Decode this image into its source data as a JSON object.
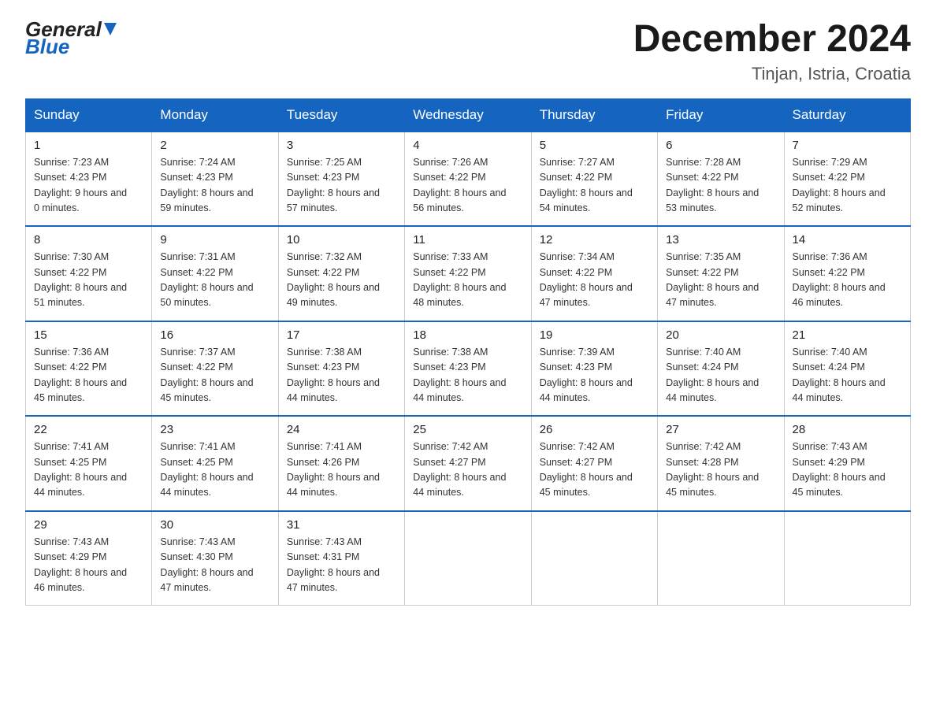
{
  "header": {
    "logo_line1": "General",
    "logo_line2": "Blue",
    "title": "December 2024",
    "subtitle": "Tinjan, Istria, Croatia"
  },
  "days_of_week": [
    "Sunday",
    "Monday",
    "Tuesday",
    "Wednesday",
    "Thursday",
    "Friday",
    "Saturday"
  ],
  "weeks": [
    [
      {
        "day": "1",
        "sunrise": "7:23 AM",
        "sunset": "4:23 PM",
        "daylight": "9 hours and 0 minutes."
      },
      {
        "day": "2",
        "sunrise": "7:24 AM",
        "sunset": "4:23 PM",
        "daylight": "8 hours and 59 minutes."
      },
      {
        "day": "3",
        "sunrise": "7:25 AM",
        "sunset": "4:23 PM",
        "daylight": "8 hours and 57 minutes."
      },
      {
        "day": "4",
        "sunrise": "7:26 AM",
        "sunset": "4:22 PM",
        "daylight": "8 hours and 56 minutes."
      },
      {
        "day": "5",
        "sunrise": "7:27 AM",
        "sunset": "4:22 PM",
        "daylight": "8 hours and 54 minutes."
      },
      {
        "day": "6",
        "sunrise": "7:28 AM",
        "sunset": "4:22 PM",
        "daylight": "8 hours and 53 minutes."
      },
      {
        "day": "7",
        "sunrise": "7:29 AM",
        "sunset": "4:22 PM",
        "daylight": "8 hours and 52 minutes."
      }
    ],
    [
      {
        "day": "8",
        "sunrise": "7:30 AM",
        "sunset": "4:22 PM",
        "daylight": "8 hours and 51 minutes."
      },
      {
        "day": "9",
        "sunrise": "7:31 AM",
        "sunset": "4:22 PM",
        "daylight": "8 hours and 50 minutes."
      },
      {
        "day": "10",
        "sunrise": "7:32 AM",
        "sunset": "4:22 PM",
        "daylight": "8 hours and 49 minutes."
      },
      {
        "day": "11",
        "sunrise": "7:33 AM",
        "sunset": "4:22 PM",
        "daylight": "8 hours and 48 minutes."
      },
      {
        "day": "12",
        "sunrise": "7:34 AM",
        "sunset": "4:22 PM",
        "daylight": "8 hours and 47 minutes."
      },
      {
        "day": "13",
        "sunrise": "7:35 AM",
        "sunset": "4:22 PM",
        "daylight": "8 hours and 47 minutes."
      },
      {
        "day": "14",
        "sunrise": "7:36 AM",
        "sunset": "4:22 PM",
        "daylight": "8 hours and 46 minutes."
      }
    ],
    [
      {
        "day": "15",
        "sunrise": "7:36 AM",
        "sunset": "4:22 PM",
        "daylight": "8 hours and 45 minutes."
      },
      {
        "day": "16",
        "sunrise": "7:37 AM",
        "sunset": "4:22 PM",
        "daylight": "8 hours and 45 minutes."
      },
      {
        "day": "17",
        "sunrise": "7:38 AM",
        "sunset": "4:23 PM",
        "daylight": "8 hours and 44 minutes."
      },
      {
        "day": "18",
        "sunrise": "7:38 AM",
        "sunset": "4:23 PM",
        "daylight": "8 hours and 44 minutes."
      },
      {
        "day": "19",
        "sunrise": "7:39 AM",
        "sunset": "4:23 PM",
        "daylight": "8 hours and 44 minutes."
      },
      {
        "day": "20",
        "sunrise": "7:40 AM",
        "sunset": "4:24 PM",
        "daylight": "8 hours and 44 minutes."
      },
      {
        "day": "21",
        "sunrise": "7:40 AM",
        "sunset": "4:24 PM",
        "daylight": "8 hours and 44 minutes."
      }
    ],
    [
      {
        "day": "22",
        "sunrise": "7:41 AM",
        "sunset": "4:25 PM",
        "daylight": "8 hours and 44 minutes."
      },
      {
        "day": "23",
        "sunrise": "7:41 AM",
        "sunset": "4:25 PM",
        "daylight": "8 hours and 44 minutes."
      },
      {
        "day": "24",
        "sunrise": "7:41 AM",
        "sunset": "4:26 PM",
        "daylight": "8 hours and 44 minutes."
      },
      {
        "day": "25",
        "sunrise": "7:42 AM",
        "sunset": "4:27 PM",
        "daylight": "8 hours and 44 minutes."
      },
      {
        "day": "26",
        "sunrise": "7:42 AM",
        "sunset": "4:27 PM",
        "daylight": "8 hours and 45 minutes."
      },
      {
        "day": "27",
        "sunrise": "7:42 AM",
        "sunset": "4:28 PM",
        "daylight": "8 hours and 45 minutes."
      },
      {
        "day": "28",
        "sunrise": "7:43 AM",
        "sunset": "4:29 PM",
        "daylight": "8 hours and 45 minutes."
      }
    ],
    [
      {
        "day": "29",
        "sunrise": "7:43 AM",
        "sunset": "4:29 PM",
        "daylight": "8 hours and 46 minutes."
      },
      {
        "day": "30",
        "sunrise": "7:43 AM",
        "sunset": "4:30 PM",
        "daylight": "8 hours and 47 minutes."
      },
      {
        "day": "31",
        "sunrise": "7:43 AM",
        "sunset": "4:31 PM",
        "daylight": "8 hours and 47 minutes."
      },
      null,
      null,
      null,
      null
    ]
  ],
  "labels": {
    "sunrise": "Sunrise: ",
    "sunset": "Sunset: ",
    "daylight": "Daylight: "
  }
}
